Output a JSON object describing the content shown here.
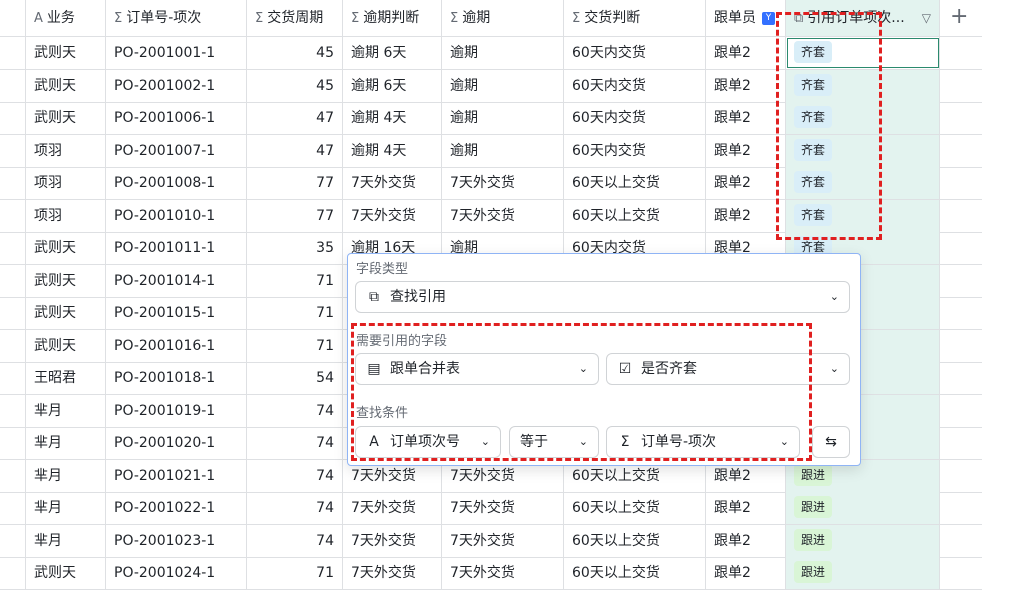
{
  "headers": [
    {
      "icon": "A",
      "label": "业务"
    },
    {
      "icon": "Σ",
      "label": "订单号-项次"
    },
    {
      "icon": "Σ",
      "label": "交货周期"
    },
    {
      "icon": "Σ",
      "label": "逾期判断"
    },
    {
      "icon": "Σ",
      "label": "逾期"
    },
    {
      "icon": "Σ",
      "label": "交货判断"
    },
    {
      "icon": "",
      "label": "跟单员"
    },
    {
      "icon": "⧉",
      "label": "引用订单项次..."
    }
  ],
  "add_column_label": "+",
  "rows": [
    {
      "biz": "武则天",
      "order": "PO-2001001-1",
      "cycle": "45",
      "overdue_judge": "逾期 6天",
      "overdue": "逾期",
      "delivery_judge": "60天内交货",
      "follower": "跟单2",
      "ref": "齐套"
    },
    {
      "biz": "武则天",
      "order": "PO-2001002-1",
      "cycle": "45",
      "overdue_judge": "逾期 6天",
      "overdue": "逾期",
      "delivery_judge": "60天内交货",
      "follower": "跟单2",
      "ref": "齐套"
    },
    {
      "biz": "武则天",
      "order": "PO-2001006-1",
      "cycle": "47",
      "overdue_judge": "逾期 4天",
      "overdue": "逾期",
      "delivery_judge": "60天内交货",
      "follower": "跟单2",
      "ref": "齐套"
    },
    {
      "biz": "项羽",
      "order": "PO-2001007-1",
      "cycle": "47",
      "overdue_judge": "逾期 4天",
      "overdue": "逾期",
      "delivery_judge": "60天内交货",
      "follower": "跟单2",
      "ref": "齐套"
    },
    {
      "biz": "项羽",
      "order": "PO-2001008-1",
      "cycle": "77",
      "overdue_judge": "7天外交货",
      "overdue": "7天外交货",
      "delivery_judge": "60天以上交货",
      "follower": "跟单2",
      "ref": "齐套"
    },
    {
      "biz": "项羽",
      "order": "PO-2001010-1",
      "cycle": "77",
      "overdue_judge": "7天外交货",
      "overdue": "7天外交货",
      "delivery_judge": "60天以上交货",
      "follower": "跟单2",
      "ref": "齐套"
    },
    {
      "biz": "武则天",
      "order": "PO-2001011-1",
      "cycle": "35",
      "overdue_judge": "逾期 16天",
      "overdue": "逾期",
      "delivery_judge": "60天内交货",
      "follower": "跟单2",
      "ref": "齐套"
    },
    {
      "biz": "武则天",
      "order": "PO-2001014-1",
      "cycle": "71",
      "overdue_judge": "",
      "overdue": "",
      "delivery_judge": "",
      "follower": "",
      "ref": ""
    },
    {
      "biz": "武则天",
      "order": "PO-2001015-1",
      "cycle": "71",
      "overdue_judge": "",
      "overdue": "",
      "delivery_judge": "",
      "follower": "",
      "ref": ""
    },
    {
      "biz": "武则天",
      "order": "PO-2001016-1",
      "cycle": "71",
      "overdue_judge": "",
      "overdue": "",
      "delivery_judge": "",
      "follower": "",
      "ref": ""
    },
    {
      "biz": "王昭君",
      "order": "PO-2001018-1",
      "cycle": "54",
      "overdue_judge": "",
      "overdue": "",
      "delivery_judge": "",
      "follower": "",
      "ref": ""
    },
    {
      "biz": "芈月",
      "order": "PO-2001019-1",
      "cycle": "74",
      "overdue_judge": "",
      "overdue": "",
      "delivery_judge": "",
      "follower": "",
      "ref": ""
    },
    {
      "biz": "芈月",
      "order": "PO-2001020-1",
      "cycle": "74",
      "overdue_judge": "",
      "overdue": "",
      "delivery_judge": "",
      "follower": "",
      "ref": ""
    },
    {
      "biz": "芈月",
      "order": "PO-2001021-1",
      "cycle": "74",
      "overdue_judge": "7天外交货",
      "overdue": "7天外交货",
      "delivery_judge": "60天以上交货",
      "follower": "跟单2",
      "ref": "跟进"
    },
    {
      "biz": "芈月",
      "order": "PO-2001022-1",
      "cycle": "74",
      "overdue_judge": "7天外交货",
      "overdue": "7天外交货",
      "delivery_judge": "60天以上交货",
      "follower": "跟单2",
      "ref": "跟进"
    },
    {
      "biz": "芈月",
      "order": "PO-2001023-1",
      "cycle": "74",
      "overdue_judge": "7天外交货",
      "overdue": "7天外交货",
      "delivery_judge": "60天以上交货",
      "follower": "跟单2",
      "ref": "跟进"
    },
    {
      "biz": "武则天",
      "order": "PO-2001024-1",
      "cycle": "71",
      "overdue_judge": "7天外交货",
      "overdue": "7天外交货",
      "delivery_judge": "60天以上交货",
      "follower": "跟单2",
      "ref": "跟进"
    }
  ],
  "popup": {
    "field_type_label": "字段类型",
    "field_type_value": "查找引用",
    "ref_field_label": "需要引用的字段",
    "ref_table": "跟单合并表",
    "ref_field": "是否齐套",
    "condition_label": "查找条件",
    "cond_field": "订单项次号",
    "cond_op": "等于",
    "cond_value": "订单号-项次"
  },
  "colors": {
    "accent_green": "#2b8a6e",
    "highlight_red": "#e02020",
    "tag_blue": "#d9eef8",
    "tag_green": "#d9f5d6"
  }
}
